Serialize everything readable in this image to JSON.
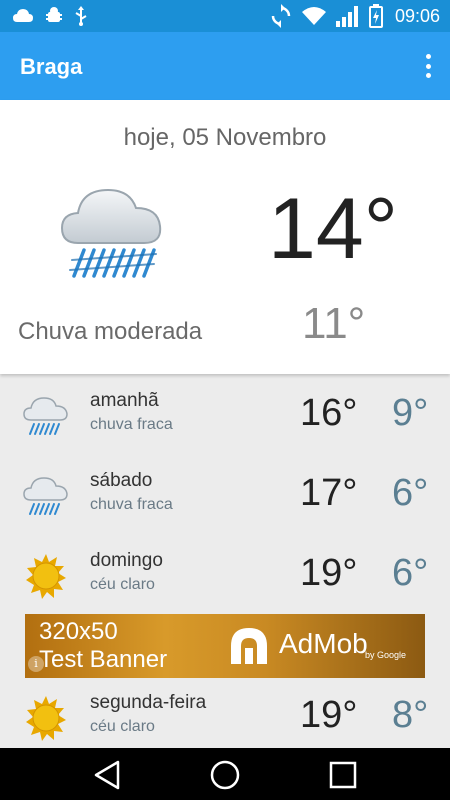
{
  "status_bar": {
    "time": "09:06",
    "left_icons": [
      "weather-cloud-icon",
      "android-debug-icon",
      "usb-icon"
    ],
    "right_icons": [
      "sync-icon",
      "wifi-icon",
      "signal-icon",
      "battery-charging-icon"
    ]
  },
  "app_bar": {
    "title": "Braga",
    "menu_icon": "more-vert-icon"
  },
  "today": {
    "date": "hoje, 05 Novembro",
    "high": "14°",
    "low": "11°",
    "condition": "Chuva moderada",
    "icon": "rain-cloud-icon"
  },
  "forecast": [
    {
      "day": "amanhã",
      "desc": "chuva fraca",
      "high": "16°",
      "low": "9°",
      "icon": "light-rain-icon"
    },
    {
      "day": "sábado",
      "desc": "chuva fraca",
      "high": "17°",
      "low": "6°",
      "icon": "light-rain-icon"
    },
    {
      "day": "domingo",
      "desc": "céu claro",
      "high": "19°",
      "low": "6°",
      "icon": "sun-icon"
    },
    {
      "day": "segunda-feira",
      "desc": "céu claro",
      "high": "19°",
      "low": "8°",
      "icon": "sun-icon"
    }
  ],
  "ad": {
    "size": "320x50",
    "label": "Test Banner",
    "brand": "AdMob",
    "by": "by Google",
    "info": "i"
  },
  "nav_bar": {
    "buttons": [
      "back-icon",
      "home-icon",
      "recents-icon"
    ]
  },
  "colors": {
    "app_bar": "#2d9ef0",
    "status_bar": "#1a8fd6",
    "low_temp": "#5b7f92",
    "sun": "#f2c010",
    "rain": "#2f89d0"
  }
}
